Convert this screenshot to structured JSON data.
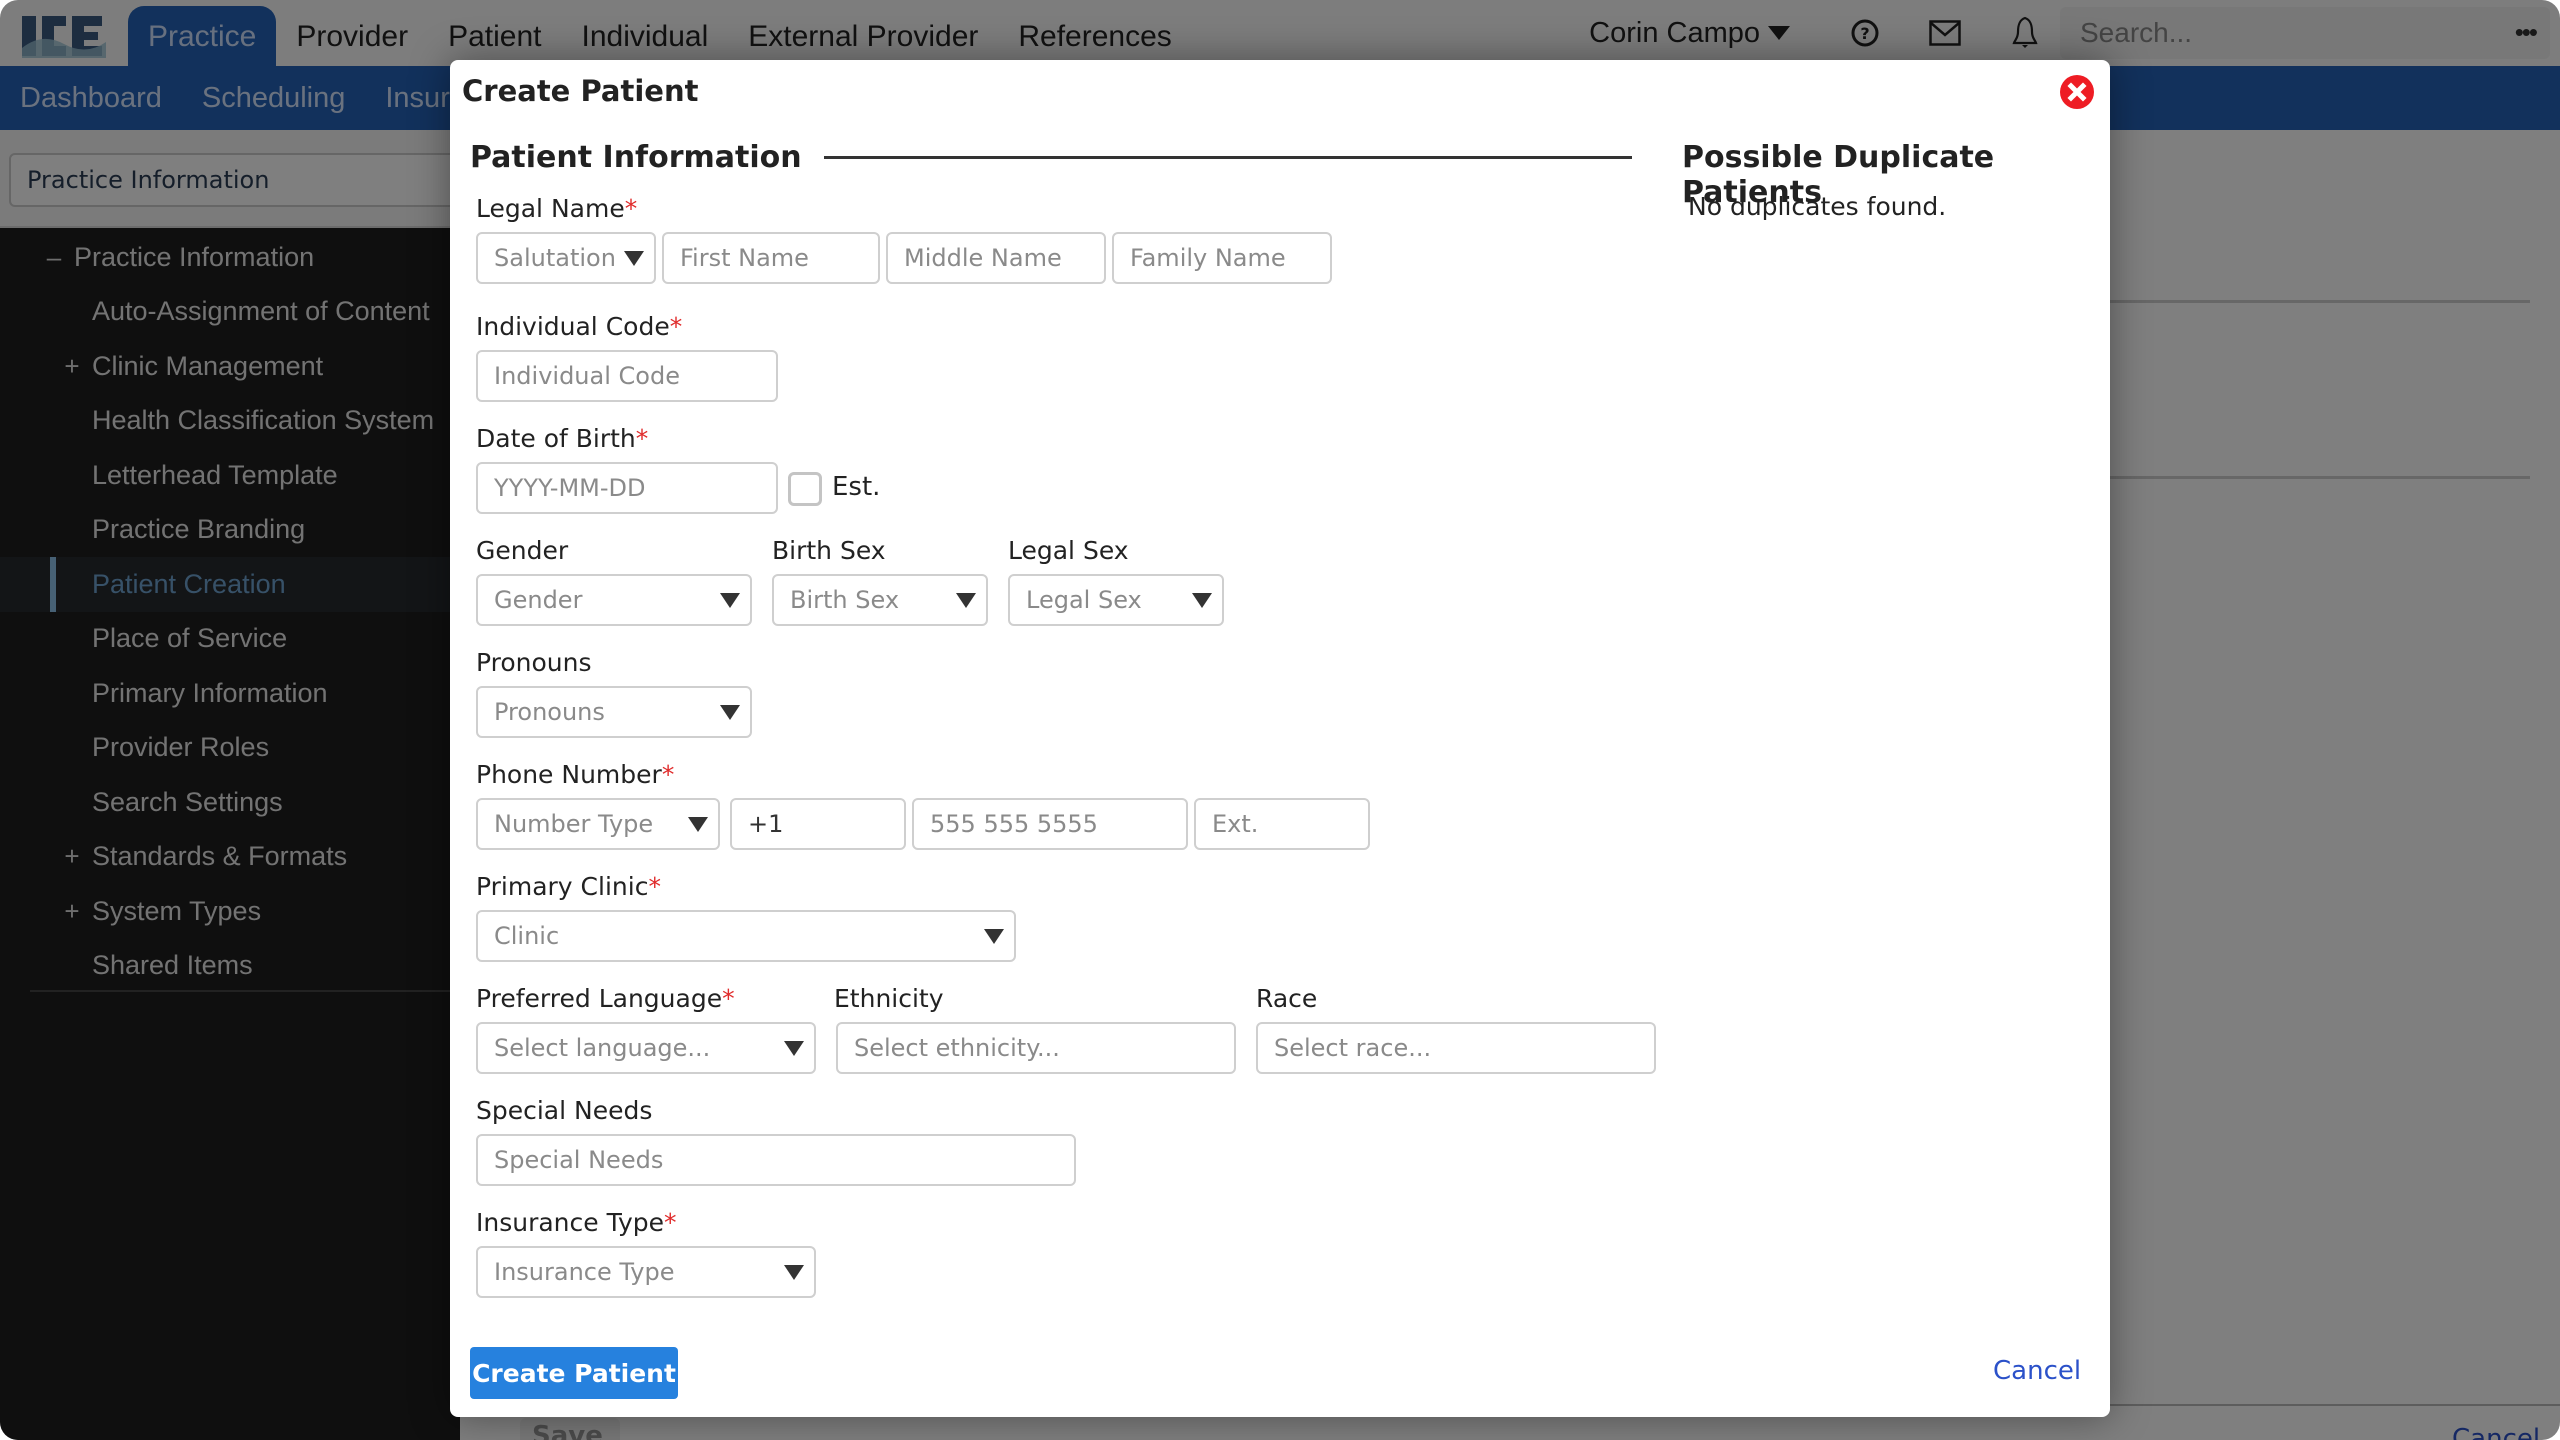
{
  "app": {
    "logo_text": "ICE",
    "top_nav": [
      "Practice",
      "Provider",
      "Patient",
      "Individual",
      "External Provider",
      "References"
    ],
    "top_nav_active": "Practice",
    "user_name": "Corin Campo",
    "search_placeholder": "Search...",
    "more_label": "•••",
    "sub_nav": [
      "Dashboard",
      "Scheduling",
      "Insurance"
    ],
    "context_selector": "Practice Information",
    "sidebar_tree": [
      {
        "label": "Practice Information",
        "toggle": "–",
        "level": 0
      },
      {
        "label": "Auto-Assignment of Content",
        "toggle": "",
        "level": 1
      },
      {
        "label": "Clinic Management",
        "toggle": "+",
        "level": 1
      },
      {
        "label": "Health Classification System",
        "toggle": "",
        "level": 1
      },
      {
        "label": "Letterhead Template",
        "toggle": "",
        "level": 1
      },
      {
        "label": "Practice Branding",
        "toggle": "",
        "level": 1
      },
      {
        "label": "Patient Creation",
        "toggle": "",
        "level": 1,
        "active": true
      },
      {
        "label": "Place of Service",
        "toggle": "",
        "level": 1
      },
      {
        "label": "Primary Information",
        "toggle": "",
        "level": 1
      },
      {
        "label": "Provider Roles",
        "toggle": "",
        "level": 1
      },
      {
        "label": "Search Settings",
        "toggle": "",
        "level": 1
      },
      {
        "label": "Standards & Formats",
        "toggle": "+",
        "level": 1
      },
      {
        "label": "System Types",
        "toggle": "+",
        "level": 1
      },
      {
        "label": "Shared Items",
        "toggle": "",
        "level": 1
      }
    ],
    "footer": {
      "save_label": "Save",
      "cancel_label": "Cancel"
    }
  },
  "modal": {
    "title": "Create Patient",
    "section_title": "Patient Information",
    "duplicates": {
      "title": "Possible Duplicate Patients",
      "message": "No duplicates found."
    },
    "required_marker": "*",
    "fields": {
      "legal_name": {
        "label": "Legal Name",
        "salutation": "Salutation",
        "first": "First Name",
        "middle": "Middle Name",
        "family": "Family Name"
      },
      "individual_code": {
        "label": "Individual Code",
        "placeholder": "Individual Code"
      },
      "dob": {
        "label": "Date of Birth",
        "placeholder": "YYYY-MM-DD",
        "est_label": "Est.",
        "est_checked": false
      },
      "gender": {
        "label": "Gender",
        "placeholder": "Gender"
      },
      "birth_sex": {
        "label": "Birth Sex",
        "placeholder": "Birth Sex"
      },
      "legal_sex": {
        "label": "Legal Sex",
        "placeholder": "Legal Sex"
      },
      "pronouns": {
        "label": "Pronouns",
        "placeholder": "Pronouns"
      },
      "phone": {
        "label": "Phone Number",
        "type_placeholder": "Number Type",
        "country_code": "+1",
        "number_placeholder": "555 555 5555",
        "ext_placeholder": "Ext."
      },
      "primary_clinic": {
        "label": "Primary Clinic",
        "placeholder": "Clinic"
      },
      "language": {
        "label": "Preferred Language",
        "placeholder": "Select language..."
      },
      "ethnicity": {
        "label": "Ethnicity",
        "placeholder": "Select ethnicity..."
      },
      "race": {
        "label": "Race",
        "placeholder": "Select race..."
      },
      "special_needs": {
        "label": "Special Needs",
        "placeholder": "Special Needs"
      },
      "insurance_type": {
        "label": "Insurance Type",
        "placeholder": "Insurance Type"
      }
    },
    "create_button": "Create Patient",
    "cancel_link": "Cancel"
  },
  "colors": {
    "brand_blue": "#2463b8",
    "primary_button": "#2681de",
    "required": "#e02b2b",
    "close_icon": "#ee1c24",
    "link": "#2b51c9"
  }
}
